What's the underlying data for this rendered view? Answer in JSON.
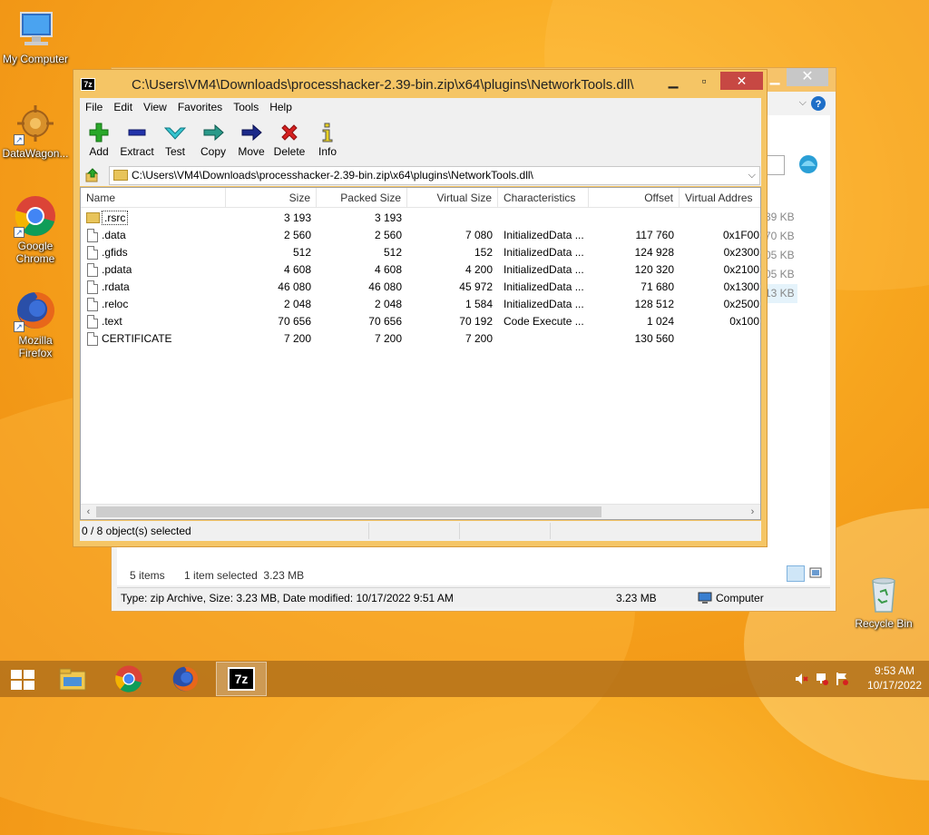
{
  "desktop": {
    "icons": [
      {
        "label": "My Computer"
      },
      {
        "label": "DataWagon..."
      },
      {
        "label": "Google Chrome"
      },
      {
        "label": "Mozilla Firefox"
      },
      {
        "label": "Recycle Bin"
      }
    ]
  },
  "explorer": {
    "sizes": [
      "39 KB",
      "70 KB",
      "05 KB",
      "05 KB",
      "13 KB"
    ],
    "items_count": "5 items",
    "selected_info": "1 item selected  3.23 MB",
    "status_text": "Type: zip Archive, Size: 3.23 MB, Date modified: 10/17/2022 9:51 AM",
    "status_size": "3.23 MB",
    "status_location": "Computer"
  },
  "sevenzip": {
    "title": "C:\\Users\\VM4\\Downloads\\processhacker-2.39-bin.zip\\x64\\plugins\\NetworkTools.dll\\",
    "app_icon_text": "7z",
    "menu": [
      "File",
      "Edit",
      "View",
      "Favorites",
      "Tools",
      "Help"
    ],
    "toolbar": {
      "add": "Add",
      "extract": "Extract",
      "test": "Test",
      "copy": "Copy",
      "move": "Move",
      "delete": "Delete",
      "info": "Info"
    },
    "address": "C:\\Users\\VM4\\Downloads\\processhacker-2.39-bin.zip\\x64\\plugins\\NetworkTools.dll\\",
    "columns": {
      "name": "Name",
      "size": "Size",
      "packed": "Packed Size",
      "vsize": "Virtual Size",
      "chars": "Characteristics",
      "offset": "Offset",
      "vaddr": "Virtual Addres"
    },
    "rows": [
      {
        "name": ".rsrc",
        "size": "3 193",
        "packed": "3 193",
        "vsize": "",
        "chars": "",
        "offset": "",
        "vaddr": ""
      },
      {
        "name": ".data",
        "size": "2 560",
        "packed": "2 560",
        "vsize": "7 080",
        "chars": "InitializedData ...",
        "offset": "117 760",
        "vaddr": "0x1F00"
      },
      {
        "name": ".gfids",
        "size": "512",
        "packed": "512",
        "vsize": "152",
        "chars": "InitializedData ...",
        "offset": "124 928",
        "vaddr": "0x2300"
      },
      {
        "name": ".pdata",
        "size": "4 608",
        "packed": "4 608",
        "vsize": "4 200",
        "chars": "InitializedData ...",
        "offset": "120 320",
        "vaddr": "0x2100"
      },
      {
        "name": ".rdata",
        "size": "46 080",
        "packed": "46 080",
        "vsize": "45 972",
        "chars": "InitializedData ...",
        "offset": "71 680",
        "vaddr": "0x1300"
      },
      {
        "name": ".reloc",
        "size": "2 048",
        "packed": "2 048",
        "vsize": "1 584",
        "chars": "InitializedData ...",
        "offset": "128 512",
        "vaddr": "0x2500"
      },
      {
        "name": ".text",
        "size": "70 656",
        "packed": "70 656",
        "vsize": "70 192",
        "chars": "Code Execute ...",
        "offset": "1 024",
        "vaddr": "0x100"
      },
      {
        "name": "CERTIFICATE",
        "size": "7 200",
        "packed": "7 200",
        "vsize": "7 200",
        "chars": "",
        "offset": "130 560",
        "vaddr": ""
      }
    ],
    "status": "0 / 8 object(s) selected"
  },
  "taskbar": {
    "time": "9:53 AM",
    "date": "10/17/2022"
  }
}
